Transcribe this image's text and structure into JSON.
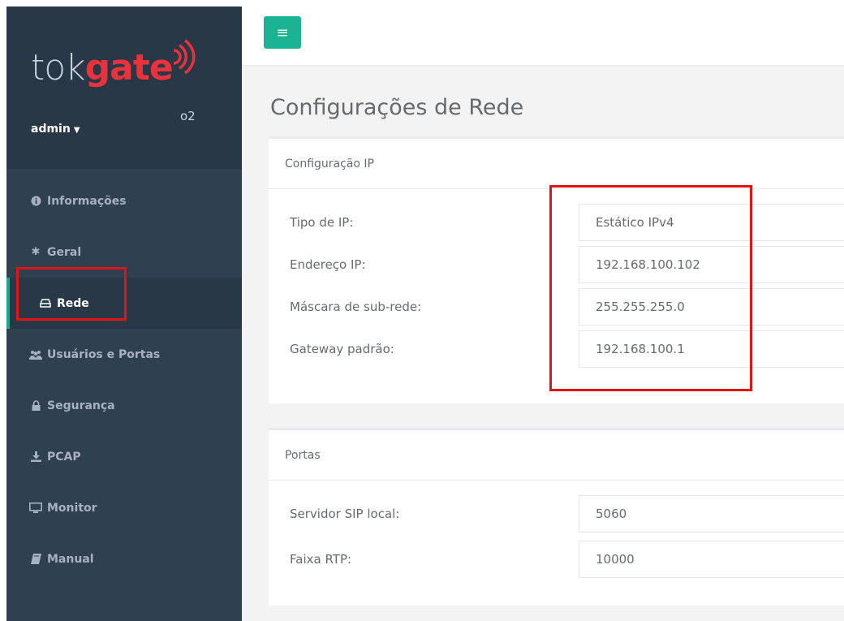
{
  "brand": {
    "name_part1": "tok",
    "name_part2": "gate",
    "subtitle": "o2",
    "accent": "#e8323c"
  },
  "user": {
    "name": "admin"
  },
  "topbar": {
    "toggle_icon": "bars-icon",
    "accent": "#1ab394"
  },
  "sidebar": {
    "items": [
      {
        "label": "Informações",
        "icon": "info-circle-icon"
      },
      {
        "label": "Geral",
        "icon": "gear-icon"
      },
      {
        "label": "Rede",
        "icon": "hdd-icon",
        "active": true
      },
      {
        "label": "Usuários e Portas",
        "icon": "users-icon"
      },
      {
        "label": "Segurança",
        "icon": "lock-icon"
      },
      {
        "label": "PCAP",
        "icon": "download-icon"
      },
      {
        "label": "Monitor",
        "icon": "desktop-icon"
      },
      {
        "label": "Manual",
        "icon": "book-icon"
      }
    ]
  },
  "page": {
    "title": "Configurações de Rede"
  },
  "ip_config": {
    "title": "Configuração IP",
    "fields": [
      {
        "label": "Tipo de IP:",
        "value": "Estático IPv4"
      },
      {
        "label": "Endereço IP:",
        "value": "192.168.100.102"
      },
      {
        "label": "Máscara de sub-rede:",
        "value": "255.255.255.0"
      },
      {
        "label": "Gateway padrão:",
        "value": "192.168.100.1"
      }
    ]
  },
  "ports": {
    "title": "Portas",
    "fields": [
      {
        "label": "Servidor SIP local:",
        "value": "5060"
      },
      {
        "label": "Faixa RTP:",
        "value": "10000"
      }
    ]
  },
  "highlight_color": "#e01515"
}
